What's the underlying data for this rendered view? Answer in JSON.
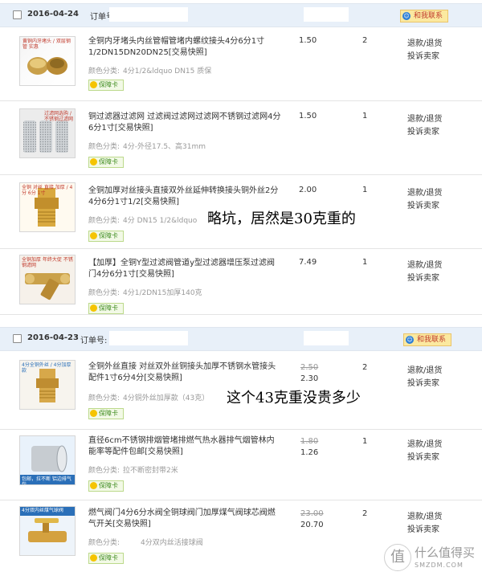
{
  "contact_label": "和我联系",
  "order_label": "订单号:",
  "badge_label": "保障卡",
  "action_refund": "退款/退货",
  "action_complaint": "投诉卖家",
  "orders": [
    {
      "date": "2016-04-24",
      "items": [
        {
          "thumb_text": "黄铜内牙堵头 / 双层钢管 实惠",
          "title": "全铜内牙堵头内丝管帽管堵内螺纹接头4分6分1寸1/2DN15DN20DN25[交易快照]",
          "sku_label": "颜色分类:",
          "sku_value": "4分1/2&ldquo DN15 质保",
          "price": "1.50",
          "qty": "2"
        },
        {
          "thumb_text": "过滤网选购 / 不锈钢过滤网",
          "title": "铜过滤器过滤网 过滤阀过滤网过滤网不锈钢过滤网4分6分1寸[交易快照]",
          "sku_label": "颜色分类:",
          "sku_value": "4分-外径17.5、高31mm",
          "price": "1.50",
          "qty": "1"
        },
        {
          "thumb_text": "全铜 对丝 直接 加厚 / 4分 6分 1寸",
          "title": "全铜加厚对丝接头直接双外丝延伸转换接头铜外丝2分4分6分1寸1/2[交易快照]",
          "sku_label": "颜色分类:",
          "sku_value": "4分 DN15 1/2&ldquo",
          "price": "2.00",
          "qty": "1"
        },
        {
          "thumb_text": "全铜加厚 年终大促 不锈钢滤网",
          "title": "【加厚】全铜Y型过滤阀管道y型过滤器增压泵过滤阀门4分6分1寸[交易快照]",
          "sku_label": "颜色分类:",
          "sku_value": "4分1/2DN15加厚140克",
          "price": "7.49",
          "qty": "1"
        }
      ]
    },
    {
      "date": "2016-04-23",
      "items": [
        {
          "thumb_text": "4分全铜外丝 / 4分加厚款",
          "title": "全铜外丝直接 对丝双外丝铜接头加厚不锈钢水管接头配件1寸6分4分[交易快照]",
          "sku_label": "颜色分类:",
          "sku_value": "4分铜外丝加厚款（43克）",
          "price_old": "2.50",
          "price_new": "2.30",
          "qty": "2"
        },
        {
          "thumb_text": "包邮，拉不断 铝边排气包",
          "title": "直径6cm不锈钢排烟管堵排燃气热水器排气烟管林内能率等配件包邮[交易快照]",
          "sku_label": "颜色分类:",
          "sku_value": "拉不断密封带2米",
          "price_old": "1.80",
          "price_new": "1.26",
          "qty": "1"
        },
        {
          "thumb_text": "4分双内丝煤气球阀",
          "title": "燃气阀门4分6分水阀全铜球阀门加厚煤气阀球芯阀燃气开关[交易快照]",
          "sku_label": "颜色分类:",
          "sku_value": "4分双内丝活接球阀",
          "price_old": "23.00",
          "price_new": "20.70",
          "qty": "2"
        }
      ]
    }
  ],
  "annotations": {
    "a1": "略坑，居然是30克重的",
    "a2": "这个43克重没贵多少"
  },
  "watermark": {
    "icon": "值",
    "line1": "什么值得买",
    "line2": "SMZDM.COM"
  },
  "colors": {
    "header_bg": "#e8f0f9",
    "badge_green": "#3d8b1d",
    "contact_red": "#c0392b"
  }
}
